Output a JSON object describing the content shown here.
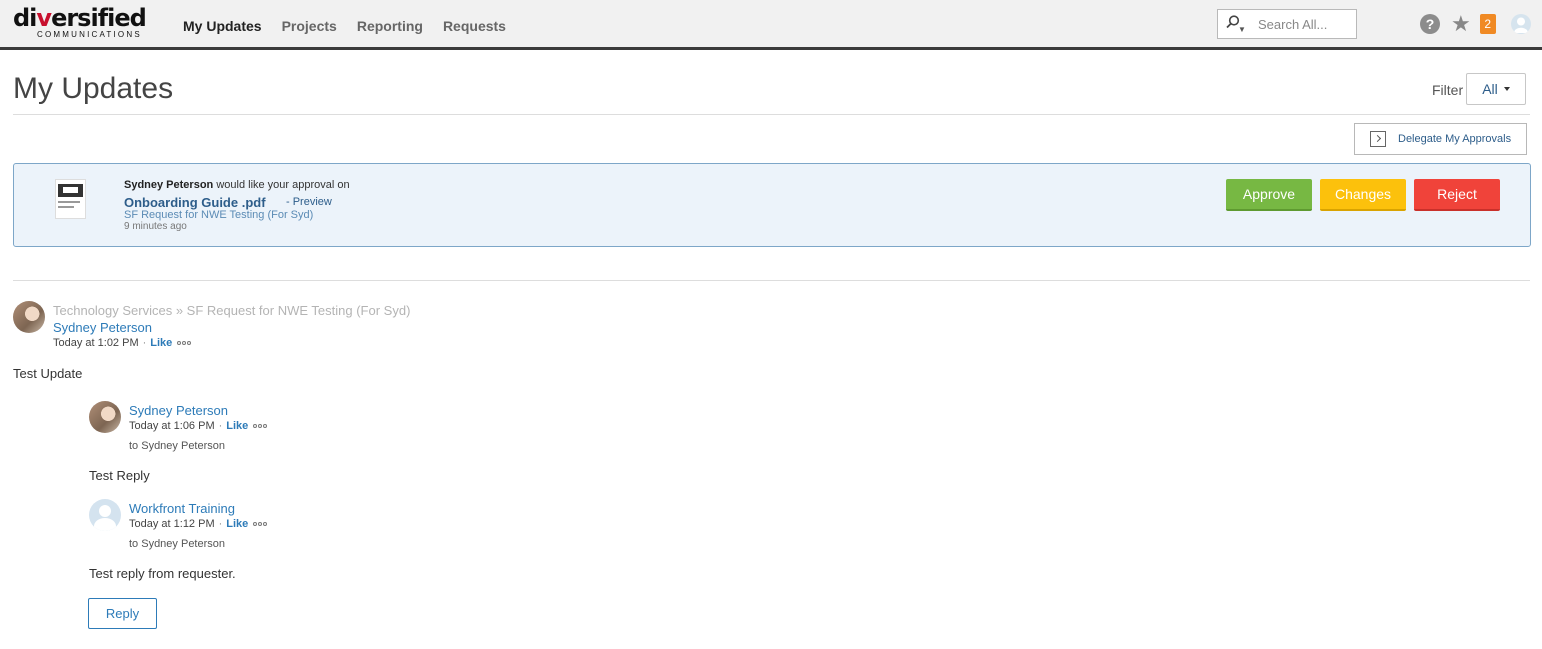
{
  "brand": {
    "logo_prefix": "di",
    "logo_accent": "v",
    "logo_suffix": "ersified",
    "logo_sub": "COMMUNICATIONS"
  },
  "nav": {
    "items": [
      "My Updates",
      "Projects",
      "Reporting",
      "Requests"
    ],
    "active": "My Updates"
  },
  "search": {
    "placeholder": "Search All..."
  },
  "header_icons": {
    "notifications_count": "2"
  },
  "page": {
    "title": "My Updates",
    "filter_label": "Filter",
    "filter_value": "All",
    "delegate_label": "Delegate My Approvals"
  },
  "approval": {
    "requester": "Sydney Peterson",
    "message": "would like your approval on",
    "document": "Onboarding Guide .pdf",
    "preview": "- Preview",
    "request": "SF Request for NWE Testing (For Syd)",
    "time": "9 minutes ago",
    "buttons": {
      "approve": "Approve",
      "changes": "Changes",
      "reject": "Reject"
    }
  },
  "update": {
    "breadcrumb": "Technology Services » SF Request for NWE Testing (For Syd)",
    "author": "Sydney Peterson",
    "time": "Today at 1:02 PM",
    "like": "Like",
    "body": "Test Update"
  },
  "replies": [
    {
      "author": "Sydney Peterson",
      "time": "Today at 1:06 PM",
      "like": "Like",
      "to": "to Sydney Peterson",
      "body": "Test Reply"
    },
    {
      "author": "Workfront Training",
      "time": "Today at 1:12 PM",
      "like": "Like",
      "to": "to Sydney Peterson",
      "body": "Test reply from requester."
    }
  ],
  "reply_button": "Reply",
  "colors": {
    "approve": "#77b843",
    "changes": "#fcc10c",
    "reject": "#f0433a",
    "link": "#2d7bb8",
    "notification": "#f08a24"
  }
}
